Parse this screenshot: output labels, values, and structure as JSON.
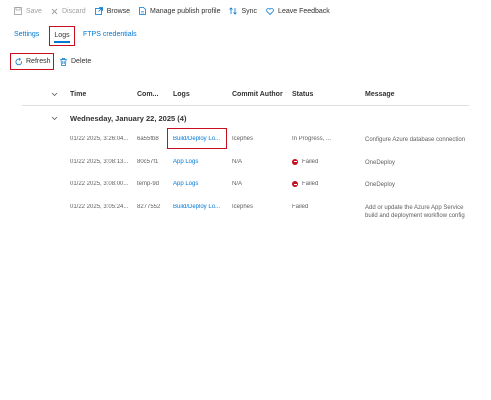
{
  "toolbar": {
    "save_label": "Save",
    "discard_label": "Discard",
    "browse_label": "Browse",
    "publish_label": "Manage publish profile",
    "sync_label": "Sync",
    "feedback_label": "Leave Feedback"
  },
  "tabs": [
    {
      "label": "Settings"
    },
    {
      "label": "Logs"
    },
    {
      "label": "FTPS credentials"
    }
  ],
  "actions": {
    "refresh_label": "Refresh",
    "delete_label": "Delete"
  },
  "columns": {
    "time": "Time",
    "commit": "Com...",
    "logs": "Logs",
    "author": "Commit Author",
    "status": "Status",
    "message": "Message"
  },
  "group": {
    "label": "Wednesday, January 22, 2025 (4)"
  },
  "rows": [
    {
      "time": "01/22 2025, 3:26:04...",
      "commit": "6a55fb8",
      "logs": "Build/Deploy Lo...",
      "author": "Icephes",
      "status": "In Progress, ...",
      "message": "Configure Azure database connection"
    },
    {
      "time": "01/22 2025, 3:08:13...",
      "commit": "80c57f1",
      "logs": "App Logs",
      "author": "N/A",
      "status": "Failed",
      "message": "OneDeploy"
    },
    {
      "time": "01/22 2025, 3:08:00...",
      "commit": "temp-9d",
      "logs": "App Logs",
      "author": "N/A",
      "status": "Failed",
      "message": "OneDeploy"
    },
    {
      "time": "01/22 2025, 3:05:24...",
      "commit": "8277552",
      "logs": "Build/Deploy Lo...",
      "author": "Icephes",
      "status": "Failed",
      "message": "Add or update the Azure App Service build and deployment workflow config"
    }
  ],
  "colors": {
    "accent": "#0078d4",
    "highlight": "#c50f1f",
    "failed": "#c50f1f"
  }
}
